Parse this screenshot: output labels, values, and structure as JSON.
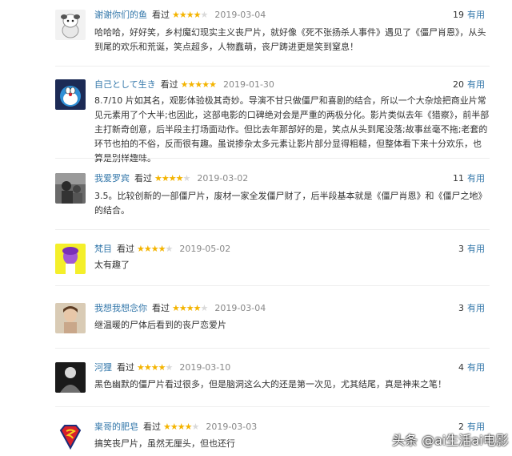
{
  "reviews": [
    {
      "user": "谢谢你们的鱼",
      "status": "看过",
      "stars": 4,
      "date": "2019-03-04",
      "useful_count": "19",
      "useful_label": "有用",
      "text": "哈哈哈，好好笑，乡村魔幻现实主义丧尸片，就好像《死不张扬杀人事件》遇见了《僵尸肖恩》，从头到尾的欢乐和荒诞，笑点超多，人物蠢萌，丧尸踌进更是笑到窒息！",
      "avatar": "sheep-avatar"
    },
    {
      "user": "自己として生き",
      "status": "看过",
      "stars": 5,
      "date": "2019-01-30",
      "useful_count": "20",
      "useful_label": "有用",
      "text": "8.7/10 片如其名，观影体验极其奇妙。导演不甘只做僵尸和喜剧的结合，所以一个大杂烩把商业片常见元素用了个大半;也因此，这部电影的口碑绝对会是严重的两极分化。影片类似去年《猎察》，前半部主打新奇创意，后半段主打场面动作。但比去年那部好的是，笑点从头到尾没落;故事丝毫不拖;老套的环节也拍的不俗，反而很有趣。虽说掺杂太多元素让影片部分显得粗糙，但整体看下来十分欢乐，也算是别样趣味。",
      "avatar": "doraemon-avatar"
    },
    {
      "user": "我爱罗宾",
      "status": "看过",
      "stars": 4,
      "date": "2019-03-02",
      "useful_count": "11",
      "useful_label": "有用",
      "text": "3.5。比较创新的一部僵尸片，废材一家全发僵尸财了，后半段基本就是《僵尸肖恩》和《僵尸之地》的结合。",
      "avatar": "bw-photo-avatar"
    },
    {
      "user": "梵目",
      "status": "看过",
      "stars": 4,
      "date": "2019-05-02",
      "useful_count": "3",
      "useful_label": "有用",
      "text": "太有趣了",
      "avatar": "purple-head-avatar"
    },
    {
      "user": "我想我想念你",
      "status": "看过",
      "stars": 4,
      "date": "2019-03-04",
      "useful_count": "3",
      "useful_label": "有用",
      "text": "继温暖的尸体后看到的丧尸恋爱片",
      "avatar": "child-photo-avatar"
    },
    {
      "user": "河狸",
      "status": "看过",
      "stars": 4,
      "date": "2019-03-10",
      "useful_count": "4",
      "useful_label": "有用",
      "text": "黑色幽默的僵尸片看过很多，但是脑洞这么大的还是第一次见，尤其结尾，真是神来之笔！",
      "avatar": "dark-figure-avatar"
    },
    {
      "user": "枽哥的肥皂",
      "status": "看过",
      "stars": 4,
      "date": "2019-03-03",
      "useful_count": "2",
      "useful_label": "有用",
      "text": "搞笑丧尸片，虽然无厘头，但也还行",
      "avatar": "superman-logo-avatar"
    }
  ],
  "watermark": "头条 @ai生活ai电影",
  "colors": {
    "link": "#3377aa",
    "star": "#f4b400",
    "date": "#888888"
  }
}
